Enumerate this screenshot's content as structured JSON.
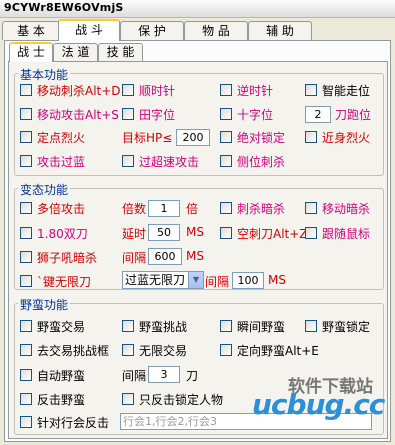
{
  "window": {
    "title": "9CYWr8EW6OVmjS"
  },
  "main_tabs": [
    "基 本",
    "战 斗",
    "保 护",
    "物 品",
    "辅 助"
  ],
  "sub_tabs": [
    "战 士",
    "法 道",
    "技 能"
  ],
  "basic": {
    "title": "基本功能",
    "move_stab": "移动刺杀Alt+D",
    "clockwise": "顺时针",
    "counterclockwise": "逆时针",
    "smart_walk": "智能走位",
    "move_attack": "移动攻击Alt+S",
    "tian_pos": "田字位",
    "cross_pos": "十字位",
    "blade_steps": "2",
    "blade_pos": "刀跑位",
    "fixed_fire": "定点烈火",
    "target_hp": "目标HP≤",
    "target_hp_value": "200",
    "absolute_lock": "绝对锁定",
    "melee_fire": "近身烈火",
    "attack_blue": "攻击过蓝",
    "overspeed": "过超速攻击",
    "side_stab": "侧位刺杀"
  },
  "abnormal": {
    "title": "变态功能",
    "multi_attack": "多倍攻击",
    "multiplier_label": "倍数",
    "multiplier_value": "1",
    "multiplier_unit": "倍",
    "stab_hidden": "刺杀暗杀",
    "move_hidden": "移动暗杀",
    "double_blade": "1.80双刀",
    "delay_label": "延时",
    "delay_value": "50",
    "delay_unit": "MS",
    "air_blade": "空刺刀Alt+Z",
    "follow_mouse": "跟随鼠标",
    "lion_roar": "狮子吼暗杀",
    "interval_label": "间隔",
    "interval_value": "600",
    "interval_unit": "MS",
    "one_key_blade": "`键无限刀",
    "blade_mode": "过蓝无限刀",
    "interval2_label": "间隔",
    "interval2_value": "100",
    "interval2_unit": "MS"
  },
  "barbarian": {
    "title": "野蛮功能",
    "trade": "野蛮交易",
    "challenge": "野蛮挑战",
    "instant": "瞬间野蛮",
    "lock": "野蛮锁定",
    "remove_trade_box": "去交易挑战框",
    "unlimited_trade": "无限交易",
    "directional": "定向野蛮Alt+E",
    "auto": "自动野蛮",
    "interval_label": "间隔",
    "interval_value": "3",
    "interval_unit": "刀",
    "counter": "反击野蛮",
    "counter_lock_only": "只反击锁定人物",
    "row_counter": "针对行会反击",
    "row_counter_placeholder": "行会1,行会2,行会3"
  },
  "watermark": {
    "line1": "软件下载站",
    "line2": "ucbug.cc"
  }
}
